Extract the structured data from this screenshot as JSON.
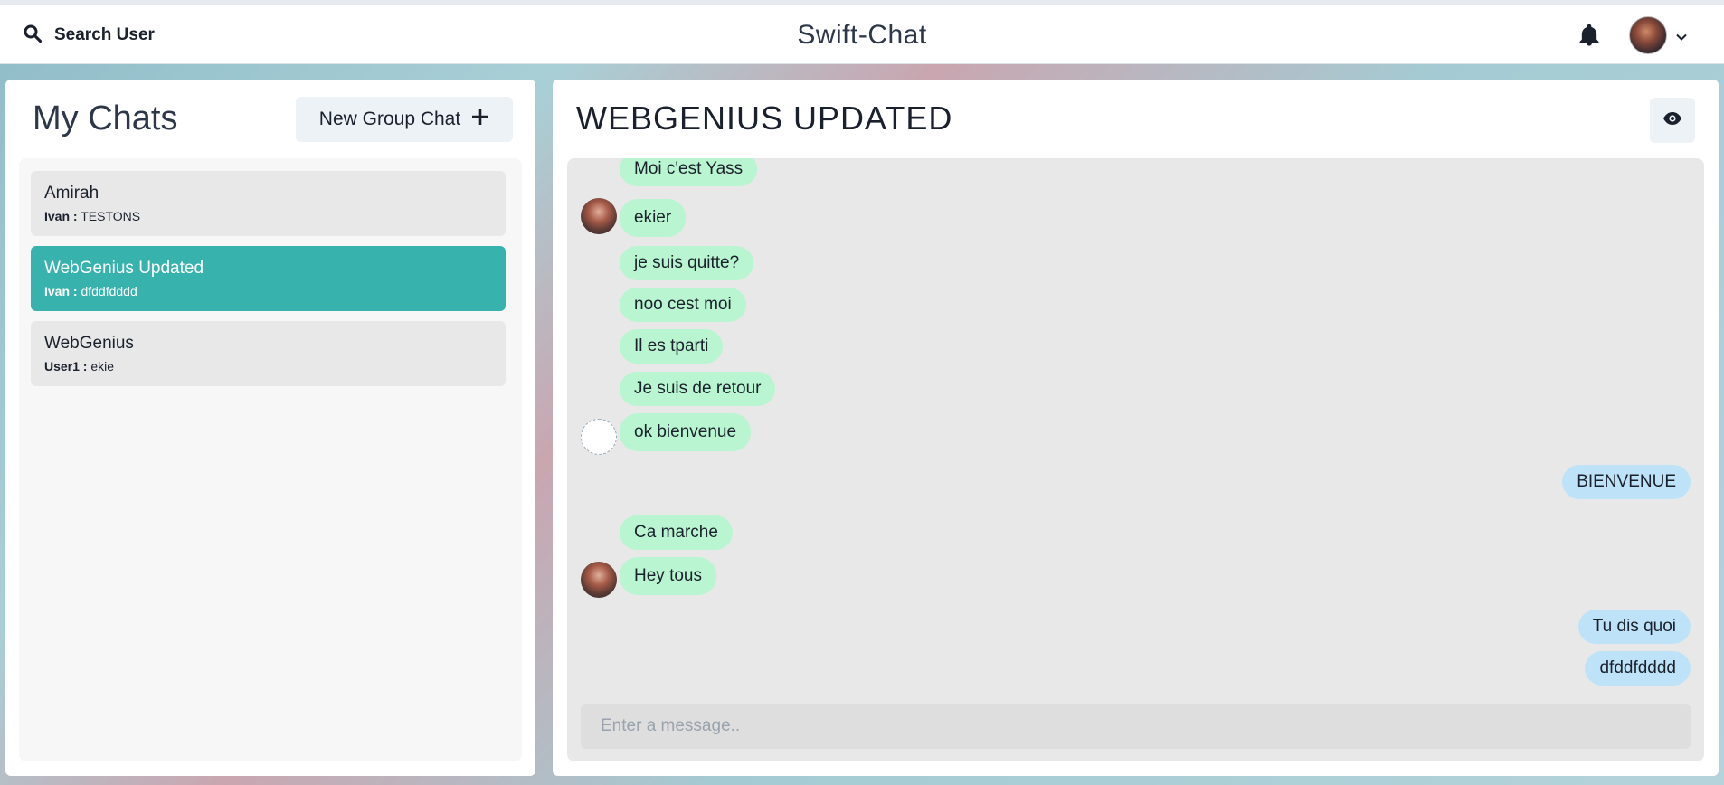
{
  "header": {
    "search_label": "Search User",
    "app_title": "Swift-Chat",
    "icons": {
      "search": "search-icon",
      "bell": "bell-icon",
      "chevron": "chevron-down-icon"
    }
  },
  "sidebar": {
    "title": "My Chats",
    "new_group_label": "New Group Chat",
    "chats": [
      {
        "name": "Amirah",
        "sender": "Ivan :",
        "last_message": "TESTONS",
        "active": false
      },
      {
        "name": "WebGenius Updated",
        "sender": "Ivan :",
        "last_message": "dfddfdddd",
        "active": true
      },
      {
        "name": "WebGenius",
        "sender": "User1 :",
        "last_message": "ekie",
        "active": false
      }
    ]
  },
  "chat": {
    "title": "WEBGENIUS UPDATED",
    "messages": [
      {
        "text": "Moi c'est Yass",
        "side": "in"
      },
      {
        "text": "ekier",
        "side": "in"
      },
      {
        "text": "je suis quitte?",
        "side": "in"
      },
      {
        "text": "noo cest moi",
        "side": "in"
      },
      {
        "text": "Il es tparti",
        "side": "in"
      },
      {
        "text": "Je suis de retour",
        "side": "in"
      },
      {
        "text": "ok bienvenue",
        "side": "in"
      },
      {
        "text": "BIENVENUE",
        "side": "out"
      },
      {
        "text": "Ca marche",
        "side": "in"
      },
      {
        "text": "Hey tous",
        "side": "in"
      },
      {
        "text": "Tu dis quoi",
        "side": "out"
      },
      {
        "text": "dfddfdddd",
        "side": "out"
      }
    ],
    "input_placeholder": "Enter a message.."
  },
  "colors": {
    "active_chat": "#38b2ac",
    "incoming_bubble": "#b9f5d0",
    "outgoing_bubble": "#bee3f8"
  }
}
